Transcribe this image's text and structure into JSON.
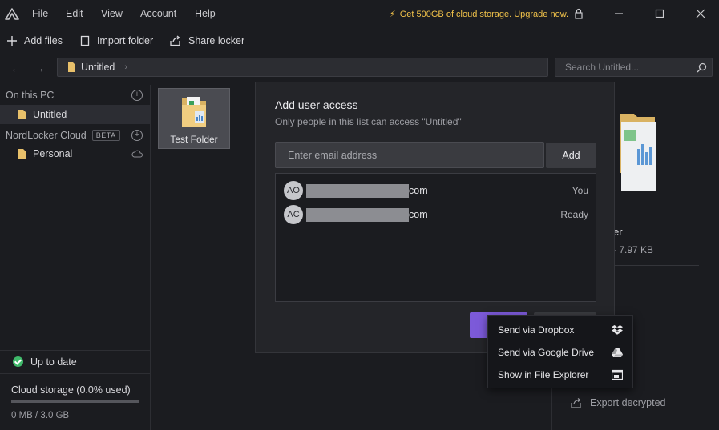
{
  "menu": {
    "items": [
      "File",
      "Edit",
      "View",
      "Account",
      "Help"
    ],
    "upgrade_text": "Get 500GB of cloud storage. Upgrade now."
  },
  "toolbar": {
    "add_files": "Add files",
    "import_folder": "Import folder",
    "share_locker": "Share locker"
  },
  "path": {
    "current": "Untitled",
    "search_placeholder": "Search Untitled..."
  },
  "sidebar": {
    "local_heading": "On this PC",
    "local_items": [
      {
        "label": "Untitled"
      }
    ],
    "cloud_heading": "NordLocker Cloud",
    "cloud_badge": "BETA",
    "cloud_items": [
      {
        "label": "Personal"
      }
    ],
    "sync_status": "Up to date",
    "storage_label": "Cloud storage (0.0% used)",
    "storage_used_fraction": 0.0,
    "storage_value": "0 MB / 3.0 GB"
  },
  "content": {
    "folder_name": "Test Folder",
    "details_name_partial": "er",
    "details_size_partial": "- 7.97 KB",
    "export_label": "Export decrypted"
  },
  "modal": {
    "title": "Add user access",
    "subtitle": "Only people in this list can access \"Untitled\"",
    "email_placeholder": "Enter email address",
    "add_label": "Add",
    "users": [
      {
        "initials": "AO",
        "email_suffix": "com",
        "status": "You"
      },
      {
        "initials": "AC",
        "email_suffix": "com",
        "status": "Ready"
      }
    ]
  },
  "context_menu": {
    "items": [
      {
        "label": "Send via Dropbox",
        "icon": "dropbox-icon"
      },
      {
        "label": "Send via Google Drive",
        "icon": "google-drive-icon"
      },
      {
        "label": "Show in File Explorer",
        "icon": "file-explorer-icon"
      }
    ]
  },
  "colors": {
    "accent": "#7c5ad9",
    "upgrade": "#f1c24a",
    "status_ok": "#3fb96a",
    "folder": "#e8c06a"
  }
}
